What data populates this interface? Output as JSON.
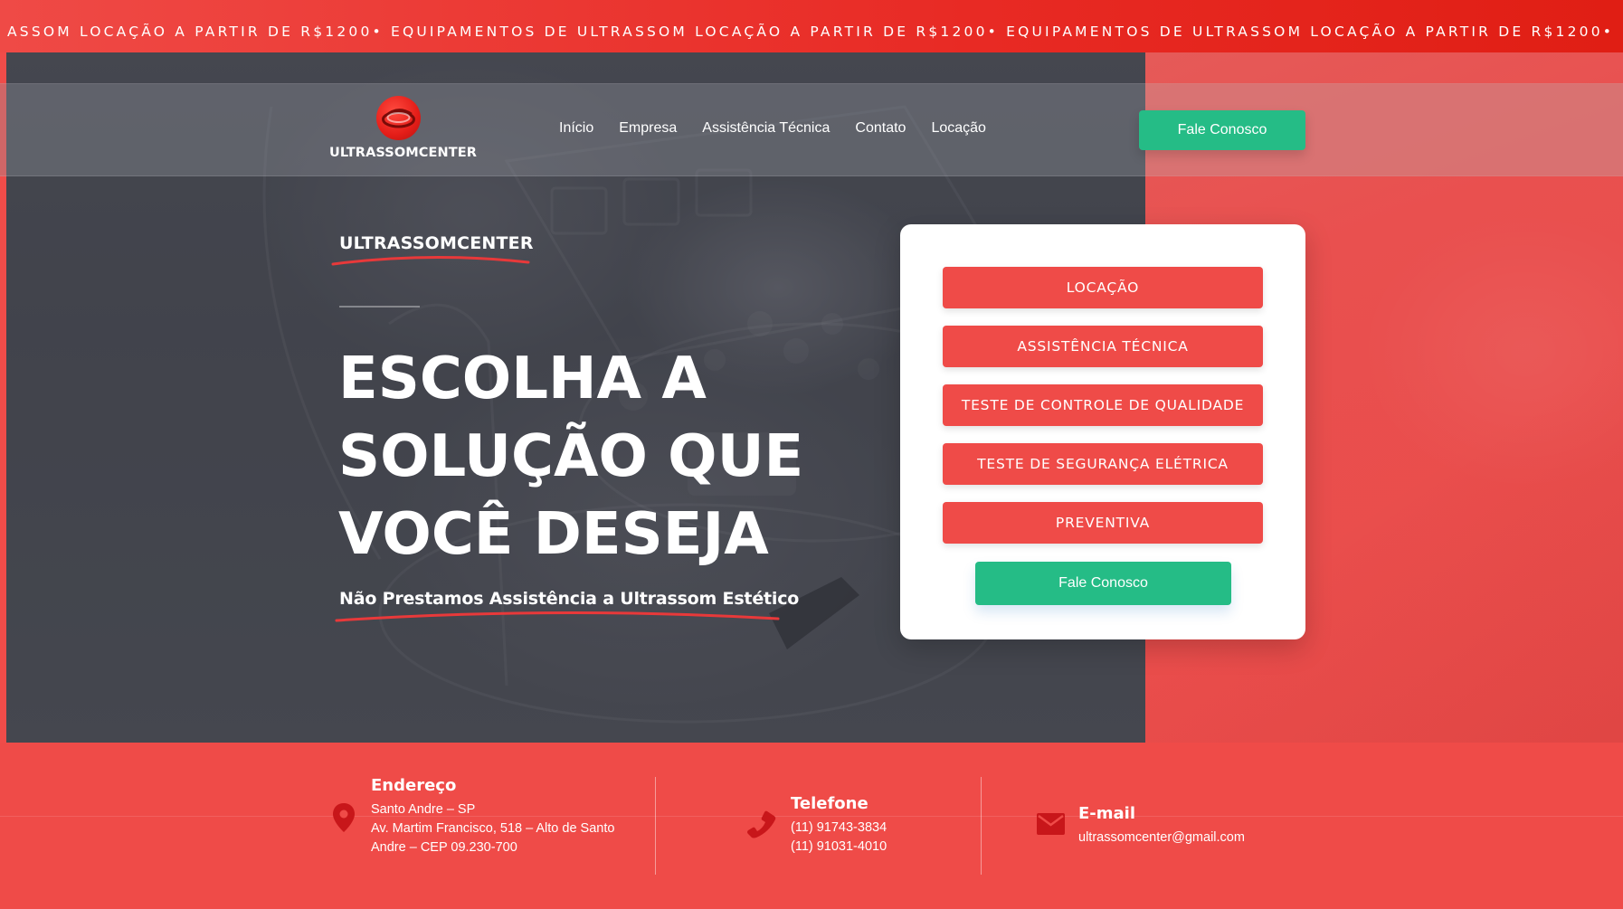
{
  "ticker": {
    "text": "ASSOM LOCAÇÃO A PARTIR DE R$1200• EQUIPAMENTOS DE ULTRASSOM LOCAÇÃO A PARTIR DE R$1200• EQUIPAMENTOS DE ULTRASSOM LOCAÇÃO A PARTIR DE R$1200•"
  },
  "header": {
    "logo_text": "ULTRASSOMCENTER",
    "nav": [
      "Início",
      "Empresa",
      "Assistência Técnica",
      "Contato",
      "Locação"
    ],
    "cta_label": "Fale Conosco"
  },
  "hero": {
    "brand": "ULTRASSOMCENTER",
    "title_lines": [
      "ESCOLHA A",
      "SOLUÇÃO QUE",
      "VOCÊ DESEJA"
    ],
    "subtitle": "Não Prestamos Assistência a Ultrassom Estético"
  },
  "card": {
    "services": [
      "LOCAÇÃO",
      "ASSISTÊNCIA TÉCNICA",
      "TESTE DE CONTROLE DE QUALIDADE",
      "TESTE DE SEGURANÇA ELÉTRICA",
      "PREVENTIVA"
    ],
    "cta_label": "Fale Conosco"
  },
  "contact": {
    "address": {
      "icon": "map-pin-icon",
      "title": "Endereço",
      "lines": [
        "Santo Andre – SP",
        "Av. Martim Francisco, 518 – Alto de Santo",
        "Andre – CEP 09.230-700"
      ]
    },
    "phone": {
      "icon": "phone-icon",
      "title": "Telefone",
      "lines": [
        "(11) 91743-3834",
        "(11) 91031-4010"
      ]
    },
    "email": {
      "icon": "envelope-icon",
      "title": "E-mail",
      "lines": [
        "ultrassomcenter@gmail.com"
      ]
    }
  },
  "colors": {
    "brand_red": "#ef4b48",
    "cta_green": "#25bc86",
    "ticker_red": "#e82a24"
  }
}
